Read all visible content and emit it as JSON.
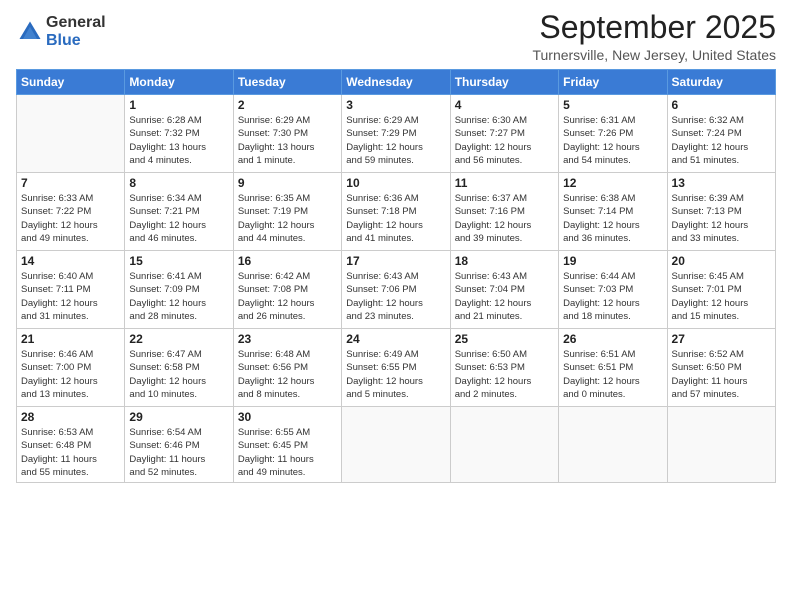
{
  "logo": {
    "general": "General",
    "blue": "Blue"
  },
  "title": "September 2025",
  "location": "Turnersville, New Jersey, United States",
  "days_header": [
    "Sunday",
    "Monday",
    "Tuesday",
    "Wednesday",
    "Thursday",
    "Friday",
    "Saturday"
  ],
  "weeks": [
    [
      {
        "day": "",
        "info": ""
      },
      {
        "day": "1",
        "info": "Sunrise: 6:28 AM\nSunset: 7:32 PM\nDaylight: 13 hours\nand 4 minutes."
      },
      {
        "day": "2",
        "info": "Sunrise: 6:29 AM\nSunset: 7:30 PM\nDaylight: 13 hours\nand 1 minute."
      },
      {
        "day": "3",
        "info": "Sunrise: 6:29 AM\nSunset: 7:29 PM\nDaylight: 12 hours\nand 59 minutes."
      },
      {
        "day": "4",
        "info": "Sunrise: 6:30 AM\nSunset: 7:27 PM\nDaylight: 12 hours\nand 56 minutes."
      },
      {
        "day": "5",
        "info": "Sunrise: 6:31 AM\nSunset: 7:26 PM\nDaylight: 12 hours\nand 54 minutes."
      },
      {
        "day": "6",
        "info": "Sunrise: 6:32 AM\nSunset: 7:24 PM\nDaylight: 12 hours\nand 51 minutes."
      }
    ],
    [
      {
        "day": "7",
        "info": "Sunrise: 6:33 AM\nSunset: 7:22 PM\nDaylight: 12 hours\nand 49 minutes."
      },
      {
        "day": "8",
        "info": "Sunrise: 6:34 AM\nSunset: 7:21 PM\nDaylight: 12 hours\nand 46 minutes."
      },
      {
        "day": "9",
        "info": "Sunrise: 6:35 AM\nSunset: 7:19 PM\nDaylight: 12 hours\nand 44 minutes."
      },
      {
        "day": "10",
        "info": "Sunrise: 6:36 AM\nSunset: 7:18 PM\nDaylight: 12 hours\nand 41 minutes."
      },
      {
        "day": "11",
        "info": "Sunrise: 6:37 AM\nSunset: 7:16 PM\nDaylight: 12 hours\nand 39 minutes."
      },
      {
        "day": "12",
        "info": "Sunrise: 6:38 AM\nSunset: 7:14 PM\nDaylight: 12 hours\nand 36 minutes."
      },
      {
        "day": "13",
        "info": "Sunrise: 6:39 AM\nSunset: 7:13 PM\nDaylight: 12 hours\nand 33 minutes."
      }
    ],
    [
      {
        "day": "14",
        "info": "Sunrise: 6:40 AM\nSunset: 7:11 PM\nDaylight: 12 hours\nand 31 minutes."
      },
      {
        "day": "15",
        "info": "Sunrise: 6:41 AM\nSunset: 7:09 PM\nDaylight: 12 hours\nand 28 minutes."
      },
      {
        "day": "16",
        "info": "Sunrise: 6:42 AM\nSunset: 7:08 PM\nDaylight: 12 hours\nand 26 minutes."
      },
      {
        "day": "17",
        "info": "Sunrise: 6:43 AM\nSunset: 7:06 PM\nDaylight: 12 hours\nand 23 minutes."
      },
      {
        "day": "18",
        "info": "Sunrise: 6:43 AM\nSunset: 7:04 PM\nDaylight: 12 hours\nand 21 minutes."
      },
      {
        "day": "19",
        "info": "Sunrise: 6:44 AM\nSunset: 7:03 PM\nDaylight: 12 hours\nand 18 minutes."
      },
      {
        "day": "20",
        "info": "Sunrise: 6:45 AM\nSunset: 7:01 PM\nDaylight: 12 hours\nand 15 minutes."
      }
    ],
    [
      {
        "day": "21",
        "info": "Sunrise: 6:46 AM\nSunset: 7:00 PM\nDaylight: 12 hours\nand 13 minutes."
      },
      {
        "day": "22",
        "info": "Sunrise: 6:47 AM\nSunset: 6:58 PM\nDaylight: 12 hours\nand 10 minutes."
      },
      {
        "day": "23",
        "info": "Sunrise: 6:48 AM\nSunset: 6:56 PM\nDaylight: 12 hours\nand 8 minutes."
      },
      {
        "day": "24",
        "info": "Sunrise: 6:49 AM\nSunset: 6:55 PM\nDaylight: 12 hours\nand 5 minutes."
      },
      {
        "day": "25",
        "info": "Sunrise: 6:50 AM\nSunset: 6:53 PM\nDaylight: 12 hours\nand 2 minutes."
      },
      {
        "day": "26",
        "info": "Sunrise: 6:51 AM\nSunset: 6:51 PM\nDaylight: 12 hours\nand 0 minutes."
      },
      {
        "day": "27",
        "info": "Sunrise: 6:52 AM\nSunset: 6:50 PM\nDaylight: 11 hours\nand 57 minutes."
      }
    ],
    [
      {
        "day": "28",
        "info": "Sunrise: 6:53 AM\nSunset: 6:48 PM\nDaylight: 11 hours\nand 55 minutes."
      },
      {
        "day": "29",
        "info": "Sunrise: 6:54 AM\nSunset: 6:46 PM\nDaylight: 11 hours\nand 52 minutes."
      },
      {
        "day": "30",
        "info": "Sunrise: 6:55 AM\nSunset: 6:45 PM\nDaylight: 11 hours\nand 49 minutes."
      },
      {
        "day": "",
        "info": ""
      },
      {
        "day": "",
        "info": ""
      },
      {
        "day": "",
        "info": ""
      },
      {
        "day": "",
        "info": ""
      }
    ]
  ]
}
